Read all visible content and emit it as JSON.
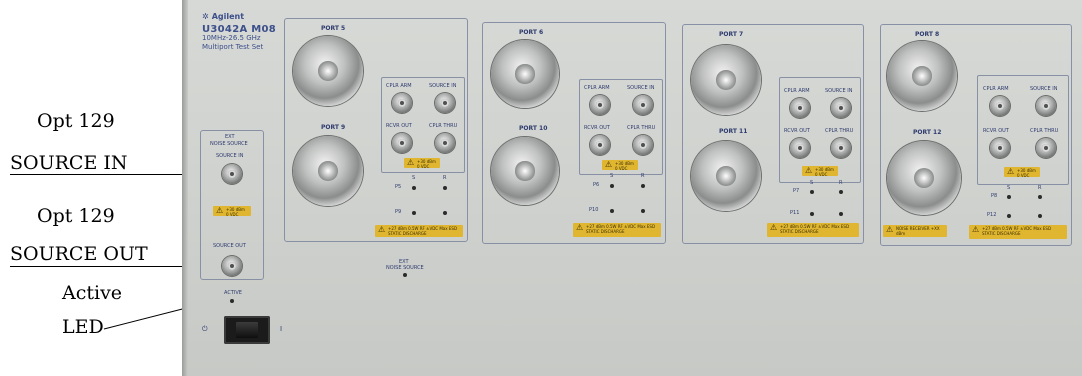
{
  "callouts": {
    "opt_129_a": "Opt 129",
    "source_in": "SOURCE IN",
    "opt_129_b": "Opt 129",
    "source_out": "SOURCE OUT",
    "active": "Active",
    "led": "LED"
  },
  "instrument": {
    "brand": "Agilent",
    "model": "U3042A M08",
    "freq_line": "10MHz-26.5 GHz",
    "desc_line": "Multiport Test Set"
  },
  "ext_noise_source_panel": {
    "title_line1": "EXT",
    "title_line2": "NOISE SOURCE",
    "source_in_label": "SOURCE IN",
    "warning": "+30 dBm 0 VDC",
    "source_out_label": "SOURCE OUT",
    "active_label": "ACTIVE"
  },
  "ext_noise_source_led": {
    "line1": "EXT",
    "line2": "NOISE SOURCE"
  },
  "power_switch": {
    "off_symbol": "⏻",
    "on_symbol": "I"
  },
  "port_groups": [
    {
      "top_port": "PORT 5",
      "bottom_port": "PORT 9",
      "cplr_arm": "CPLR ARM",
      "source_in": "SOURCE IN",
      "rcvr_out": "RCVR OUT",
      "cplr_thru": "CPLR THRU",
      "sub_warning": "+30 dBm 0 VDC",
      "s_label": "S",
      "r_label": "R",
      "led_row1": "P5",
      "led_row2": "P9",
      "warning": "+27 dBm 0.5W RF ±VDC Max ESD STATIC DISCHARGE"
    },
    {
      "top_port": "PORT 6",
      "bottom_port": "PORT 10",
      "cplr_arm": "CPLR ARM",
      "source_in": "SOURCE IN",
      "rcvr_out": "RCVR OUT",
      "cplr_thru": "CPLR THRU",
      "sub_warning": "+30 dBm 0 VDC",
      "s_label": "S",
      "r_label": "R",
      "led_row1": "P6",
      "led_row2": "P10",
      "warning": "+27 dBm 0.5W RF ±VDC Max ESD STATIC DISCHARGE"
    },
    {
      "top_port": "PORT 7",
      "bottom_port": "PORT 11",
      "cplr_arm": "CPLR ARM",
      "source_in": "SOURCE IN",
      "rcvr_out": "RCVR OUT",
      "cplr_thru": "CPLR THRU",
      "sub_warning": "+30 dBm 0 VDC",
      "s_label": "S",
      "r_label": "R",
      "led_row1": "P7",
      "led_row2": "P11",
      "warning": "+27 dBm 0.5W RF ±VDC Max ESD STATIC DISCHARGE"
    },
    {
      "top_port": "PORT 8",
      "bottom_port": "PORT 12",
      "cplr_arm": "CPLR ARM",
      "source_in": "SOURCE IN",
      "rcvr_out": "RCVR OUT",
      "cplr_thru": "CPLR THRU",
      "sub_warning": "+30 dBm 0 VDC",
      "s_label": "S",
      "r_label": "R",
      "led_row1": "P8",
      "led_row2": "P12",
      "noise_warning": "NOISE RECEIVER +XX dBm",
      "warning": "+27 dBm 0.5W RF ±VDC Max ESD STATIC DISCHARGE"
    }
  ],
  "colors": {
    "panel": "#d2d4d1",
    "print": "#2e3b6e",
    "warning_label": "#e0b630",
    "connector": "#a9abaa"
  }
}
